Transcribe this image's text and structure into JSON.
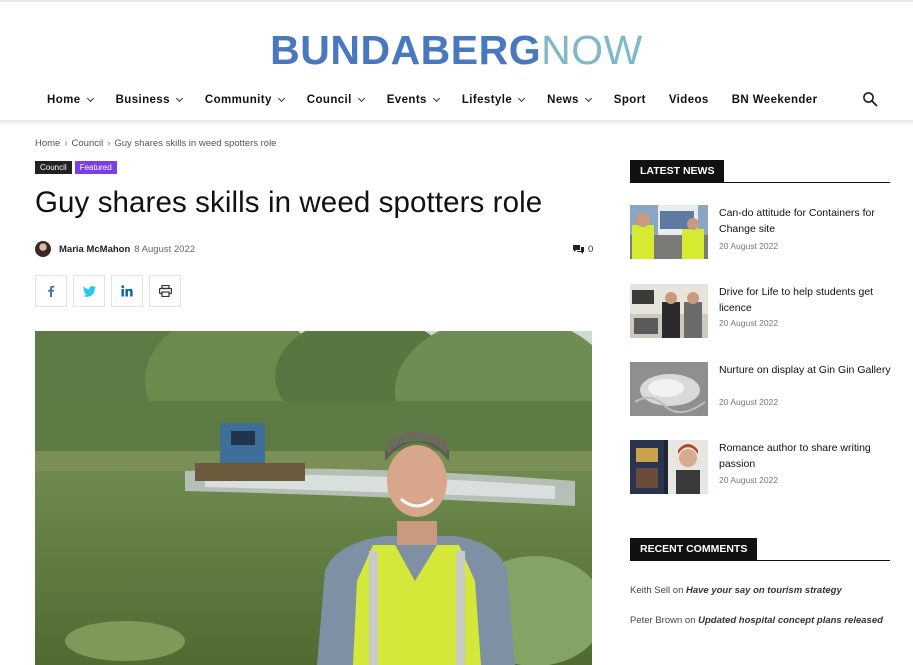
{
  "site": {
    "logo_part1": "BUNDABERG",
    "logo_part2": "NOW"
  },
  "nav": {
    "items": [
      {
        "label": "Home",
        "dropdown": true
      },
      {
        "label": "Business",
        "dropdown": true
      },
      {
        "label": "Community",
        "dropdown": true
      },
      {
        "label": "Council",
        "dropdown": true
      },
      {
        "label": "Events",
        "dropdown": true
      },
      {
        "label": "Lifestyle",
        "dropdown": true
      },
      {
        "label": "News",
        "dropdown": true
      },
      {
        "label": "Sport",
        "dropdown": false
      },
      {
        "label": "Videos",
        "dropdown": false
      },
      {
        "label": "BN Weekender",
        "dropdown": false
      }
    ],
    "search_icon": "search-icon"
  },
  "breadcrumb": {
    "items": [
      "Home",
      "Council",
      "Guy shares skills in weed spotters role"
    ],
    "separator": "›"
  },
  "article": {
    "tags": [
      "Council",
      "Featured"
    ],
    "title": "Guy shares skills in weed spotters role",
    "author": "Maria McMahon",
    "date": "8 August 2022",
    "comment_count": "0",
    "share_icons": [
      "facebook-icon",
      "twitter-icon",
      "linkedin-icon",
      "print-icon"
    ]
  },
  "sidebar": {
    "latest_news_heading": "LATEST NEWS",
    "latest_news": [
      {
        "title": "Can-do attitude for Containers for Change site",
        "date": "20 August 2022"
      },
      {
        "title": "Drive for Life to help students get licence",
        "date": "20 August 2022"
      },
      {
        "title": "Nurture on display at Gin Gin Gallery",
        "date": "20 August 2022"
      },
      {
        "title": "Romance author to share writing passion",
        "date": "20 August 2022"
      }
    ],
    "recent_comments_heading": "RECENT COMMENTS",
    "recent_comments": [
      {
        "author": "Keith Sell",
        "on": "on",
        "post": "Have your say on tourism strategy"
      },
      {
        "author": "Peter Brown",
        "on": "on",
        "post": "Updated hospital concept plans released"
      }
    ]
  },
  "colors": {
    "logo_blue": "#4a78be",
    "logo_teal": "#7fb8c7",
    "tag_featured": "#7b3fe4",
    "tag_council": "#222222"
  }
}
